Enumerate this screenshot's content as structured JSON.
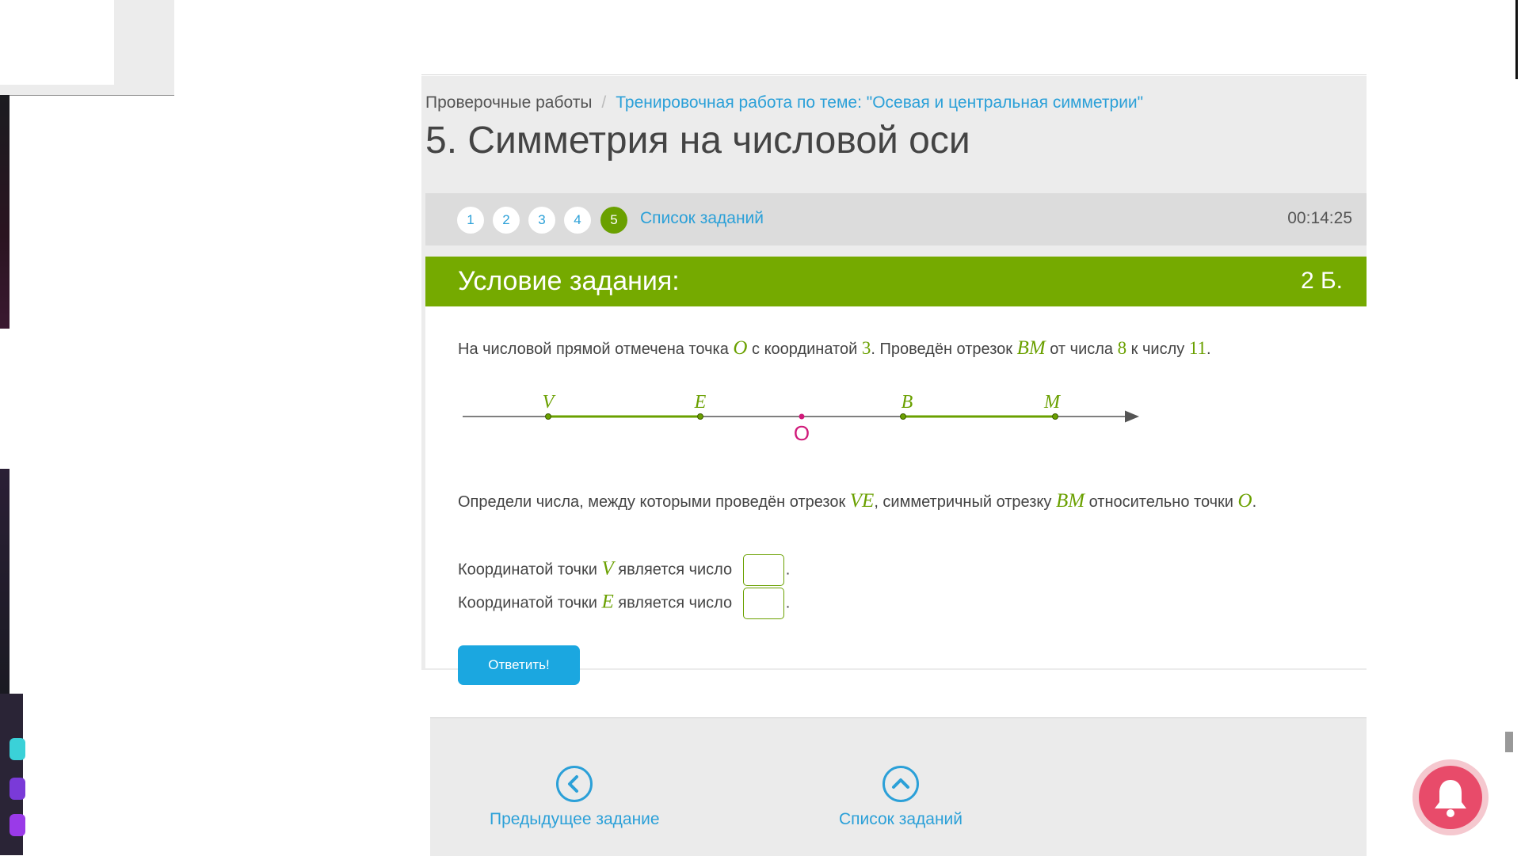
{
  "breadcrumb": {
    "root": "Проверочные работы",
    "separator": "/",
    "current": "Тренировочная работа по теме: \"Осевая и центральная симметрии\""
  },
  "page_title": "5. Симметрия на числовой оси",
  "task_nav": {
    "numbers": [
      "1",
      "2",
      "3",
      "4",
      "5"
    ],
    "active": "5",
    "list_link": "Список заданий",
    "timer": "00:14:25"
  },
  "card": {
    "heading": "Условие задания:",
    "points": "2 Б.",
    "problem": {
      "p1": "На числовой прямой отмечена точка",
      "pointO": "O",
      "p2": "с координатой",
      "coordO": "3",
      "p3": ". Проведён отрезок",
      "segBM": "BM",
      "p4": "от числа",
      "from": "8",
      "p5": "к числу",
      "to": "11",
      "p6": "."
    },
    "number_line": {
      "labels": [
        "V",
        "E",
        "B",
        "M"
      ],
      "origin_label": "O"
    },
    "question": {
      "q1": "Определи числа, между которыми проведён отрезок",
      "segVE": "VE",
      "q2": ", симметричный отрезку",
      "segBM": "BM",
      "q3": "относительно точки",
      "pointO": "O",
      "q4": "."
    },
    "answers": [
      {
        "pre": "Координатой точки",
        "point": "V",
        "post": "является число",
        "end": "."
      },
      {
        "pre": "Координатой точки",
        "point": "E",
        "post": "является число",
        "end": "."
      }
    ],
    "submit_label": "Ответить!"
  },
  "footer": {
    "prev_label": "Предыдущее задание",
    "list_label": "Список заданий"
  },
  "colors": {
    "accent_green": "#75aa00",
    "link_blue": "#2ba0d8",
    "button_blue": "#1ba7e0",
    "origin_pink": "#d01a7a",
    "bell_red": "#e84b6a"
  }
}
